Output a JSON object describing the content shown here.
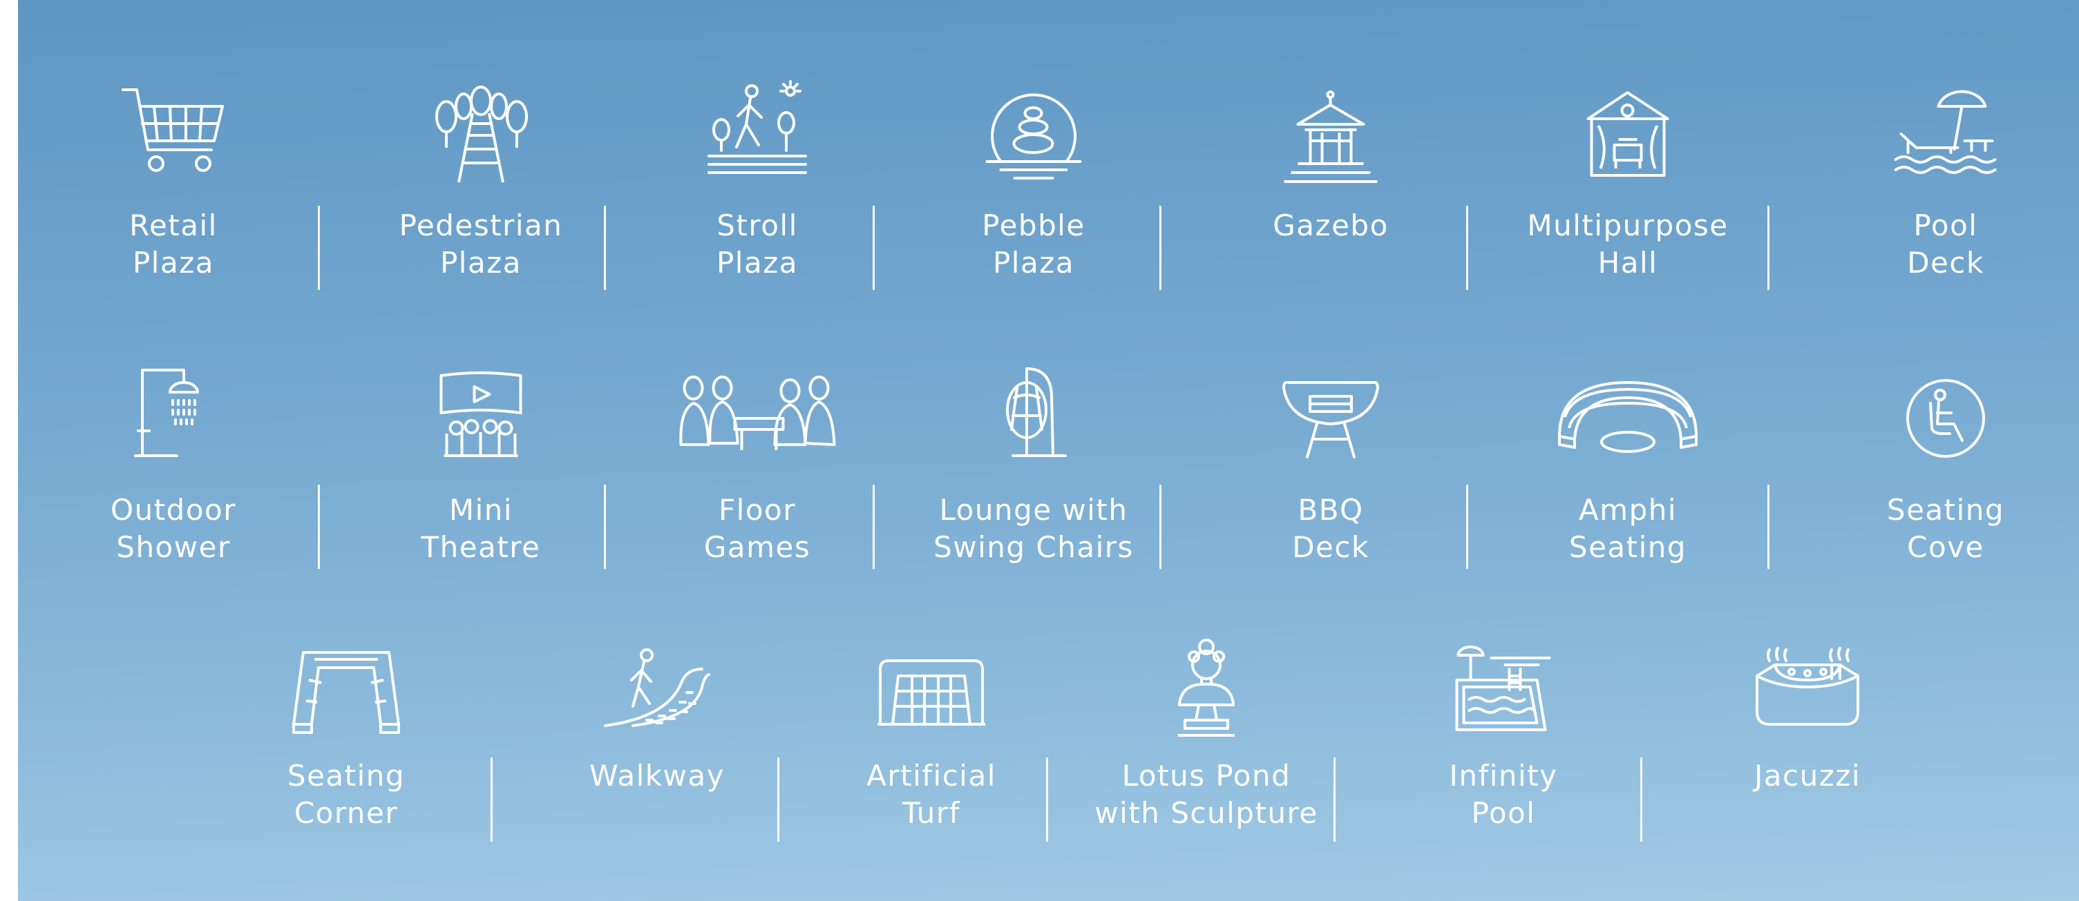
{
  "amenities": [
    {
      "icon": "shopping-cart-icon",
      "line1": "Retail",
      "line2": "Plaza"
    },
    {
      "icon": "tree-path-icon",
      "line1": "Pedestrian",
      "line2": "Plaza"
    },
    {
      "icon": "stroller-walk-icon",
      "line1": "Stroll",
      "line2": "Plaza"
    },
    {
      "icon": "pebble-stack-icon",
      "line1": "Pebble",
      "line2": "Plaza"
    },
    {
      "icon": "gazebo-icon",
      "line1": "Gazebo",
      "line2": ""
    },
    {
      "icon": "hall-building-icon",
      "line1": "Multipurpose",
      "line2": "Hall"
    },
    {
      "icon": "pool-deck-umbrella-icon",
      "line1": "Pool",
      "line2": "Deck"
    },
    {
      "icon": "outdoor-shower-icon",
      "line1": "Outdoor",
      "line2": "Shower"
    },
    {
      "icon": "theatre-screen-icon",
      "line1": "Mini",
      "line2": "Theatre"
    },
    {
      "icon": "floor-games-people-icon",
      "line1": "Floor",
      "line2": "Games"
    },
    {
      "icon": "swing-chair-icon",
      "line1": "Lounge with",
      "line2": "Swing Chairs"
    },
    {
      "icon": "bbq-grill-icon",
      "line1": "BBQ",
      "line2": "Deck"
    },
    {
      "icon": "amphitheatre-icon",
      "line1": "Amphi",
      "line2": "Seating"
    },
    {
      "icon": "seated-person-icon",
      "line1": "Seating",
      "line2": "Cove"
    },
    {
      "icon": "seating-corner-icon",
      "line1": "Seating",
      "line2": "Corner"
    },
    {
      "icon": "walkway-person-icon",
      "line1": "Walkway",
      "line2": ""
    },
    {
      "icon": "goal-net-icon",
      "line1": "Artificial",
      "line2": "Turf"
    },
    {
      "icon": "bust-sculpture-icon",
      "line1": "Lotus Pond",
      "line2": "with Sculpture"
    },
    {
      "icon": "infinity-pool-icon",
      "line1": "Infinity",
      "line2": "Pool"
    },
    {
      "icon": "jacuzzi-icon",
      "line1": "Jacuzzi",
      "line2": ""
    }
  ],
  "colors": {
    "background_top": "#5e97c3",
    "background_bottom": "#a2cbe6",
    "foreground": "#ffffff"
  }
}
